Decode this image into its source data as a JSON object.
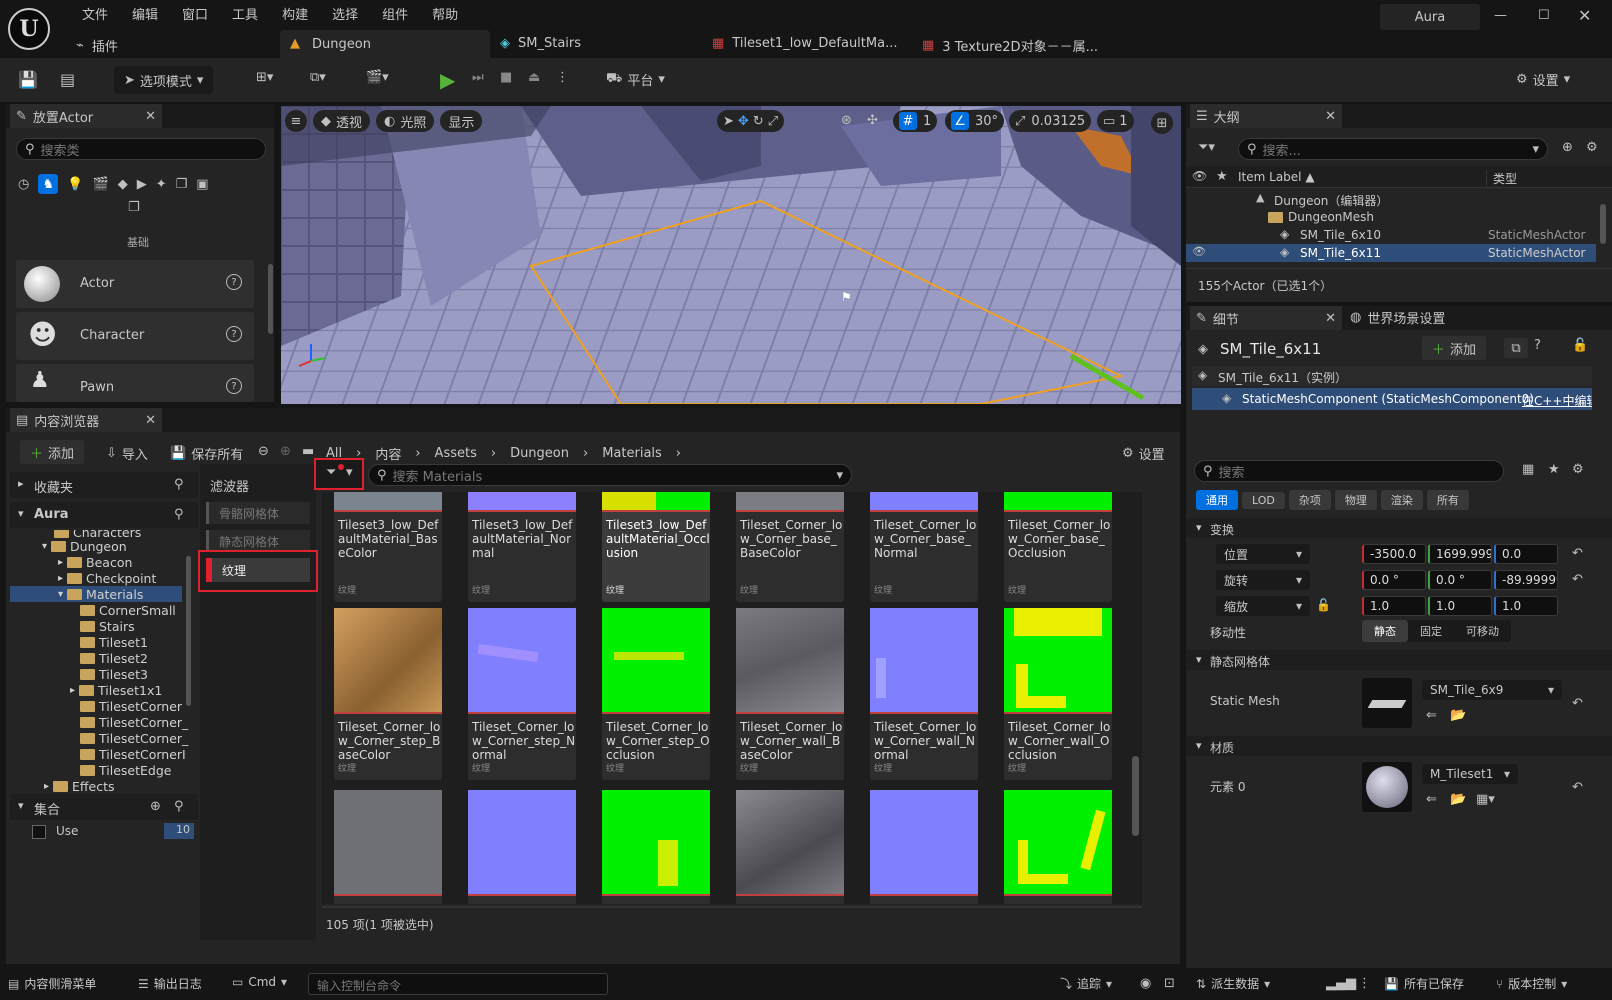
{
  "menu": {
    "items": [
      "文件",
      "编辑",
      "窗口",
      "工具",
      "构建",
      "选择",
      "组件",
      "帮助"
    ],
    "plugins": "插件",
    "project": "Aura"
  },
  "tabs": [
    {
      "label": "Dungeon"
    },
    {
      "label": "SM_Stairs"
    },
    {
      "label": "Tileset1_low_DefaultMa..."
    },
    {
      "label": "3 Texture2D对象－－属..."
    }
  ],
  "toolbar": {
    "mode": "选项模式",
    "platform": "平台",
    "settings": "设置"
  },
  "place_actor": {
    "title": "放置Actor",
    "search_placeholder": "搜索类",
    "category": "基础",
    "items": [
      "Actor",
      "Character",
      "Pawn"
    ]
  },
  "viewport": {
    "perspective": "透视",
    "lit": "光照",
    "show": "显示",
    "grid": "1",
    "angle": "30°",
    "scale": "0.03125",
    "camera": "1"
  },
  "outliner": {
    "title": "大纲",
    "search_placeholder": "搜索...",
    "col_label": "Item Label ▲",
    "col_type": "类型",
    "rows": [
      {
        "label": "Dungeon（编辑器）",
        "type": ""
      },
      {
        "label": "DungeonMesh",
        "type": ""
      },
      {
        "label": "SM_Tile_6x10",
        "type": "StaticMeshActor"
      },
      {
        "label": "SM_Tile_6x11",
        "type": "StaticMeshActor"
      }
    ],
    "count": "155个Actor（已选1个）"
  },
  "details": {
    "tab_details": "细节",
    "tab_world": "世界场景设置",
    "actor_name": "SM_Tile_6x11",
    "add": "添加",
    "instance": "SM_Tile_6x11（实例）",
    "component": "StaticMeshComponent (StaticMeshComponent0)",
    "component_note": "在C++中编辑",
    "search_placeholder": "搜索",
    "filters": [
      "通用",
      "LOD",
      "杂项",
      "物理",
      "渲染",
      "所有"
    ],
    "transform_section": "变换",
    "location_label": "位置",
    "rotation_label": "旋转",
    "scale_label": "缩放",
    "location": [
      "-3500.0",
      "1699.9999",
      "0.0"
    ],
    "rotation": [
      "0.0 °",
      "0.0 °",
      "-89.99999"
    ],
    "scale": [
      "1.0",
      "1.0",
      "1.0"
    ],
    "mobility_label": "移动性",
    "mobility": [
      "静态",
      "固定",
      "可移动"
    ],
    "static_mesh_section": "静态网格体",
    "static_mesh_label": "Static Mesh",
    "static_mesh_value": "SM_Tile_6x9",
    "materials_section": "材质",
    "element_label": "元素 0",
    "material_value": "M_Tileset1"
  },
  "content_browser": {
    "title": "内容浏览器",
    "add": "添加",
    "import": "导入",
    "save_all": "保存所有",
    "settings": "设置",
    "breadcrumb": [
      "All",
      "内容",
      "Assets",
      "Dungeon",
      "Materials"
    ],
    "favorites": "收藏夹",
    "root": "Aura",
    "tree": [
      {
        "label": "Characters",
        "depth": 2
      },
      {
        "label": "Dungeon",
        "depth": 2
      },
      {
        "label": "Beacon",
        "depth": 3
      },
      {
        "label": "Checkpoint",
        "depth": 3
      },
      {
        "label": "Materials",
        "depth": 3
      },
      {
        "label": "CornerSmall",
        "depth": 4
      },
      {
        "label": "Stairs",
        "depth": 4
      },
      {
        "label": "Tileset1",
        "depth": 4
      },
      {
        "label": "Tileset2",
        "depth": 4
      },
      {
        "label": "Tileset3",
        "depth": 4
      },
      {
        "label": "Tileset1x1",
        "depth": 4
      },
      {
        "label": "TilesetCorner",
        "depth": 4
      },
      {
        "label": "TilesetCorner_",
        "depth": 4
      },
      {
        "label": "TilesetCorner_",
        "depth": 4
      },
      {
        "label": "TilesetCornerI",
        "depth": 4
      },
      {
        "label": "TilesetEdge",
        "depth": 4
      },
      {
        "label": "Effects",
        "depth": 2
      }
    ],
    "collections": "集合",
    "collection_item": "Use",
    "collection_count": "10",
    "filters_title": "滤波器",
    "filters": [
      "骨骼网格体",
      "静态网格体",
      "纹理"
    ],
    "search_placeholder": "搜索 Materials",
    "assets": [
      {
        "name": "Tileset3_low_DefaultMaterial_BaseColor",
        "type": "纹理"
      },
      {
        "name": "Tileset3_low_DefaultMaterial_Normal",
        "type": "纹理"
      },
      {
        "name": "Tileset3_low_DefaultMaterial_Occlusion",
        "type": "纹理"
      },
      {
        "name": "Tileset_Corner_low_Corner_base_BaseColor",
        "type": "纹理"
      },
      {
        "name": "Tileset_Corner_low_Corner_base_Normal",
        "type": "纹理"
      },
      {
        "name": "Tileset_Corner_low_Corner_base_Occlusion",
        "type": "纹理"
      },
      {
        "name": "Tileset_Corner_low_Corner_step_BaseColor",
        "type": "纹理"
      },
      {
        "name": "Tileset_Corner_low_Corner_step_Normal",
        "type": "纹理"
      },
      {
        "name": "Tileset_Corner_low_Corner_step_Occlusion",
        "type": "纹理"
      },
      {
        "name": "Tileset_Corner_low_Corner_wall_BaseColor",
        "type": "纹理"
      },
      {
        "name": "Tileset_Corner_low_Corner_wall_Normal",
        "type": "纹理"
      },
      {
        "name": "Tileset_Corner_low_Corner_wall_Occlusion",
        "type": "纹理"
      }
    ],
    "status": "105 项(1 项被选中)"
  },
  "statusbar": {
    "drawer": "内容侧滑菜单",
    "output": "输出日志",
    "cmd": "Cmd",
    "console_placeholder": "输入控制台命令",
    "trace": "追踪",
    "derived": "派生数据",
    "saved": "所有已保存",
    "source_control": "版本控制"
  },
  "colors": {
    "accent": "#0070e0",
    "selection": "#2e4d78",
    "highlight_red": "#e0202e",
    "play": "#58b33c",
    "normal_map": "#8080ff",
    "occlusion": "#00ff00"
  }
}
